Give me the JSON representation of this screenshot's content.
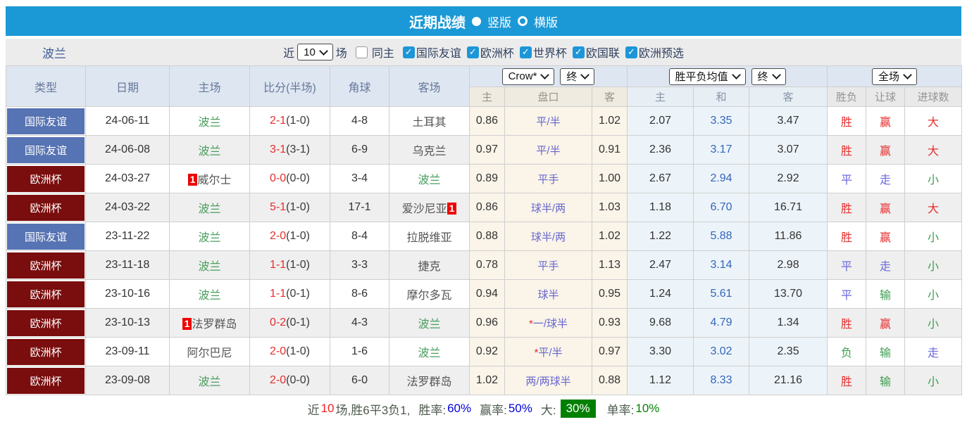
{
  "title_bar": {
    "title": "近期战绩",
    "vertical_label": "竖版",
    "horizontal_label": "横版"
  },
  "filter_bar": {
    "team": "波兰",
    "near_label": "近",
    "games_value": "10",
    "games_unit": "场",
    "same_home_label": "同主",
    "same_home_checked": false,
    "league_filters": [
      {
        "label": "国际友谊",
        "checked": true
      },
      {
        "label": "欧洲杯",
        "checked": true
      },
      {
        "label": "世界杯",
        "checked": true
      },
      {
        "label": "欧国联",
        "checked": true
      },
      {
        "label": "欧洲预选",
        "checked": true
      }
    ]
  },
  "table": {
    "headers": {
      "type": "类型",
      "date": "日期",
      "home": "主场",
      "score": "比分(半场)",
      "corners": "角球",
      "away": "客场"
    },
    "selects": {
      "asia_source": "Crow*",
      "asia_stage": "终",
      "europe_source": "胜平负均值",
      "europe_stage": "终",
      "result_scope": "全场"
    },
    "sub_headers": {
      "asia_home": "主",
      "asia_line": "盘口",
      "asia_away": "客",
      "europe_home": "主",
      "europe_draw": "和",
      "europe_away": "客",
      "result_wdl": "胜负",
      "result_handicap": "让球",
      "result_goals": "进球数"
    },
    "rows": [
      {
        "league": "国际友谊",
        "league_type": "friendly",
        "date": "24-06-11",
        "home": {
          "name": "波兰",
          "subject": true
        },
        "score": "2-1",
        "half": "(1-0)",
        "corners": "4-8",
        "away": {
          "name": "土耳其"
        },
        "asia": {
          "home": "0.86",
          "line": "平/半",
          "away": "1.02"
        },
        "europe": {
          "home": "2.07",
          "draw": "3.35",
          "away": "3.47"
        },
        "results": {
          "wdl": {
            "text": "胜",
            "color": "red"
          },
          "handicap": {
            "text": "赢",
            "color": "red"
          },
          "goals": {
            "text": "大",
            "color": "red"
          }
        }
      },
      {
        "league": "国际友谊",
        "league_type": "friendly",
        "date": "24-06-08",
        "home": {
          "name": "波兰",
          "subject": true
        },
        "score": "3-1",
        "half": "(3-1)",
        "corners": "6-9",
        "away": {
          "name": "乌克兰"
        },
        "asia": {
          "home": "0.97",
          "line": "平/半",
          "away": "0.91"
        },
        "europe": {
          "home": "2.36",
          "draw": "3.17",
          "away": "3.07"
        },
        "results": {
          "wdl": {
            "text": "胜",
            "color": "red"
          },
          "handicap": {
            "text": "赢",
            "color": "red"
          },
          "goals": {
            "text": "大",
            "color": "red"
          }
        }
      },
      {
        "league": "欧洲杯",
        "league_type": "eurocup",
        "date": "24-03-27",
        "home": {
          "name": "威尔士",
          "badge_before": "1"
        },
        "score": "0-0",
        "half": "(0-0)",
        "corners": "3-4",
        "away": {
          "name": "波兰",
          "subject": true
        },
        "asia": {
          "home": "0.89",
          "line": "平手",
          "away": "1.00"
        },
        "europe": {
          "home": "2.67",
          "draw": "2.94",
          "away": "2.92"
        },
        "results": {
          "wdl": {
            "text": "平",
            "color": "blue"
          },
          "handicap": {
            "text": "走",
            "color": "blue"
          },
          "goals": {
            "text": "小",
            "color": "green"
          }
        }
      },
      {
        "league": "欧洲杯",
        "league_type": "eurocup",
        "date": "24-03-22",
        "home": {
          "name": "波兰",
          "subject": true
        },
        "score": "5-1",
        "half": "(1-0)",
        "corners": "17-1",
        "away": {
          "name": "爱沙尼亚",
          "badge_after": "1"
        },
        "asia": {
          "home": "0.86",
          "line": "球半/两",
          "away": "1.03"
        },
        "europe": {
          "home": "1.18",
          "draw": "6.70",
          "away": "16.71"
        },
        "results": {
          "wdl": {
            "text": "胜",
            "color": "red"
          },
          "handicap": {
            "text": "赢",
            "color": "red"
          },
          "goals": {
            "text": "大",
            "color": "red"
          }
        }
      },
      {
        "league": "国际友谊",
        "league_type": "friendly",
        "date": "23-11-22",
        "home": {
          "name": "波兰",
          "subject": true
        },
        "score": "2-0",
        "half": "(1-0)",
        "corners": "8-4",
        "away": {
          "name": "拉脱维亚"
        },
        "asia": {
          "home": "0.88",
          "line": "球半/两",
          "away": "1.02"
        },
        "europe": {
          "home": "1.22",
          "draw": "5.88",
          "away": "11.86"
        },
        "results": {
          "wdl": {
            "text": "胜",
            "color": "red"
          },
          "handicap": {
            "text": "赢",
            "color": "red"
          },
          "goals": {
            "text": "小",
            "color": "green"
          }
        }
      },
      {
        "league": "欧洲杯",
        "league_type": "eurocup",
        "date": "23-11-18",
        "home": {
          "name": "波兰",
          "subject": true
        },
        "score": "1-1",
        "half": "(1-0)",
        "corners": "3-3",
        "away": {
          "name": "捷克"
        },
        "asia": {
          "home": "0.78",
          "line": "平手",
          "away": "1.13"
        },
        "europe": {
          "home": "2.47",
          "draw": "3.14",
          "away": "2.98"
        },
        "results": {
          "wdl": {
            "text": "平",
            "color": "blue"
          },
          "handicap": {
            "text": "走",
            "color": "blue"
          },
          "goals": {
            "text": "小",
            "color": "green"
          }
        }
      },
      {
        "league": "欧洲杯",
        "league_type": "eurocup",
        "date": "23-10-16",
        "home": {
          "name": "波兰",
          "subject": true
        },
        "score": "1-1",
        "half": "(0-1)",
        "corners": "8-6",
        "away": {
          "name": "摩尔多瓦"
        },
        "asia": {
          "home": "0.94",
          "line": "球半",
          "away": "0.95"
        },
        "europe": {
          "home": "1.24",
          "draw": "5.61",
          "away": "13.70"
        },
        "results": {
          "wdl": {
            "text": "平",
            "color": "blue"
          },
          "handicap": {
            "text": "输",
            "color": "green"
          },
          "goals": {
            "text": "小",
            "color": "green"
          }
        }
      },
      {
        "league": "欧洲杯",
        "league_type": "eurocup",
        "date": "23-10-13",
        "home": {
          "name": "法罗群岛",
          "badge_before": "1"
        },
        "score": "0-2",
        "half": "(0-1)",
        "corners": "4-3",
        "away": {
          "name": "波兰",
          "subject": true
        },
        "asia": {
          "home": "0.96",
          "line": "*一/球半",
          "away": "0.93"
        },
        "europe": {
          "home": "9.68",
          "draw": "4.79",
          "away": "1.34"
        },
        "results": {
          "wdl": {
            "text": "胜",
            "color": "red"
          },
          "handicap": {
            "text": "赢",
            "color": "red"
          },
          "goals": {
            "text": "小",
            "color": "green"
          }
        }
      },
      {
        "league": "欧洲杯",
        "league_type": "eurocup",
        "date": "23-09-11",
        "home": {
          "name": "阿尔巴尼"
        },
        "score": "2-0",
        "half": "(1-0)",
        "corners": "1-6",
        "away": {
          "name": "波兰",
          "subject": true
        },
        "asia": {
          "home": "0.92",
          "line": "*平/半",
          "away": "0.97"
        },
        "europe": {
          "home": "3.30",
          "draw": "3.02",
          "away": "2.35"
        },
        "results": {
          "wdl": {
            "text": "负",
            "color": "green"
          },
          "handicap": {
            "text": "输",
            "color": "green"
          },
          "goals": {
            "text": "走",
            "color": "blue"
          }
        }
      },
      {
        "league": "欧洲杯",
        "league_type": "eurocup",
        "date": "23-09-08",
        "home": {
          "name": "波兰",
          "subject": true
        },
        "score": "2-0",
        "half": "(0-0)",
        "corners": "6-0",
        "away": {
          "name": "法罗群岛"
        },
        "asia": {
          "home": "1.02",
          "line": "两/两球半",
          "away": "0.88"
        },
        "europe": {
          "home": "1.12",
          "draw": "8.33",
          "away": "21.16"
        },
        "results": {
          "wdl": {
            "text": "胜",
            "color": "red"
          },
          "handicap": {
            "text": "输",
            "color": "green"
          },
          "goals": {
            "text": "小",
            "color": "green"
          }
        }
      }
    ]
  },
  "footer": {
    "near_label": "近",
    "count": "10",
    "summary": "场,胜6平3负1,",
    "win_rate_label": "胜率:",
    "win_rate": "60%",
    "handicap_rate_label": "赢率:",
    "handicap_rate": "50%",
    "big_label": "大:",
    "big_rate": "30%",
    "single_label": "单率:",
    "single_rate": "10%"
  },
  "colors": {
    "accent_blue": "#1b99d6",
    "friendly_badge": "#5673b3",
    "eurocup_badge": "#7a0d0d",
    "subject_team_green": "#4a9e5f",
    "score_red": "#e62e2e",
    "handicap_line_blue": "#6666cc",
    "draw_blue": "#6a6ade",
    "lose_green": "#3d9e50",
    "rate_blue": "#0000dd",
    "rate_green": "#008000"
  }
}
